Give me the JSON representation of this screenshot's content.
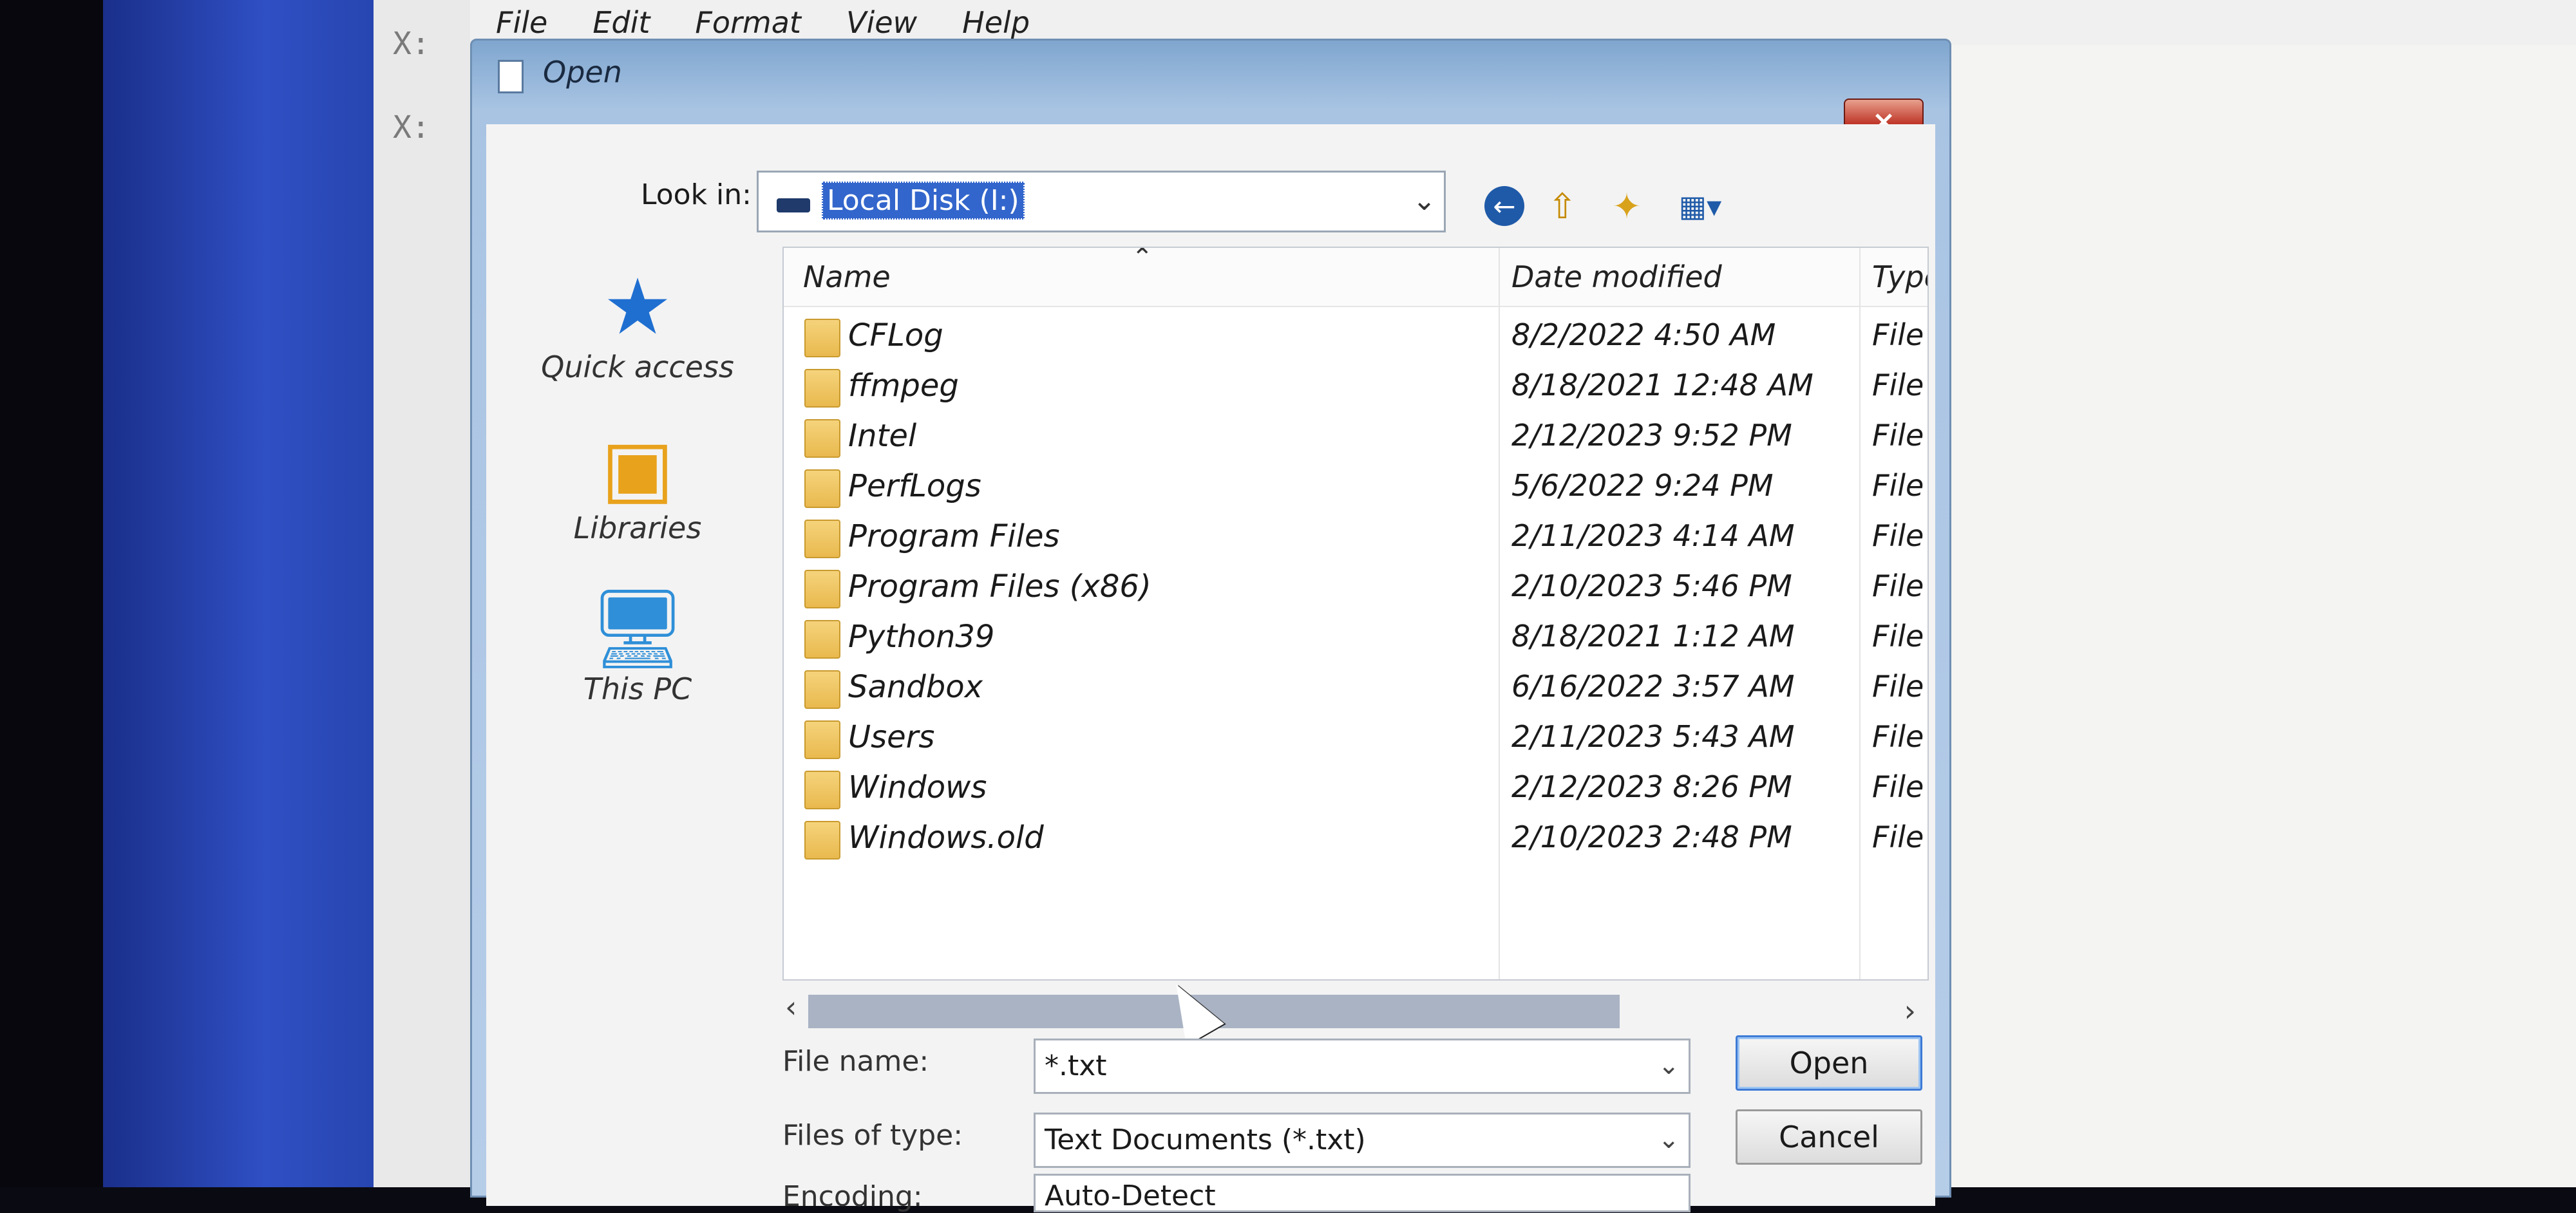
{
  "menubar": {
    "items": [
      "File",
      "Edit",
      "Format",
      "View",
      "Help"
    ]
  },
  "bg_markers": [
    "X:",
    "X:"
  ],
  "dialog": {
    "title": "Open",
    "close_label": "×",
    "look_in_label": "Look in:",
    "look_in_value": "Local Disk (I:)",
    "toolbar_icons": [
      "back-icon",
      "up-folder-icon",
      "new-folder-icon",
      "view-menu-icon"
    ],
    "places": [
      {
        "label": "Quick access",
        "icon": "star-icon"
      },
      {
        "label": "Libraries",
        "icon": "libraries-icon"
      },
      {
        "label": "This PC",
        "icon": "computer-icon"
      }
    ],
    "columns": {
      "name": "Name",
      "date": "Date modified",
      "type": "Type"
    },
    "rows": [
      {
        "name": "CFLog",
        "date": "8/2/2022 4:50 AM",
        "type": "File fc"
      },
      {
        "name": "ffmpeg",
        "date": "8/18/2021 12:48 AM",
        "type": "File fc"
      },
      {
        "name": "Intel",
        "date": "2/12/2023 9:52 PM",
        "type": "File fc"
      },
      {
        "name": "PerfLogs",
        "date": "5/6/2022 9:24 PM",
        "type": "File fc"
      },
      {
        "name": "Program Files",
        "date": "2/11/2023 4:14 AM",
        "type": "File fc"
      },
      {
        "name": "Program Files (x86)",
        "date": "2/10/2023 5:46 PM",
        "type": "File fc"
      },
      {
        "name": "Python39",
        "date": "8/18/2021 1:12 AM",
        "type": "File fc"
      },
      {
        "name": "Sandbox",
        "date": "6/16/2022 3:57 AM",
        "type": "File fc"
      },
      {
        "name": "Users",
        "date": "2/11/2023 5:43 AM",
        "type": "File fc"
      },
      {
        "name": "Windows",
        "date": "2/12/2023 8:26 PM",
        "type": "File fc"
      },
      {
        "name": "Windows.old",
        "date": "2/10/2023 2:48 PM",
        "type": "File fc"
      }
    ],
    "file_name_label": "File name:",
    "file_name_value": "*.txt",
    "file_type_label": "Files of type:",
    "file_type_value": "Text Documents (*.txt)",
    "encoding_label": "Encoding:",
    "encoding_value": "Auto-Detect",
    "open_button": "Open",
    "cancel_button": "Cancel"
  }
}
